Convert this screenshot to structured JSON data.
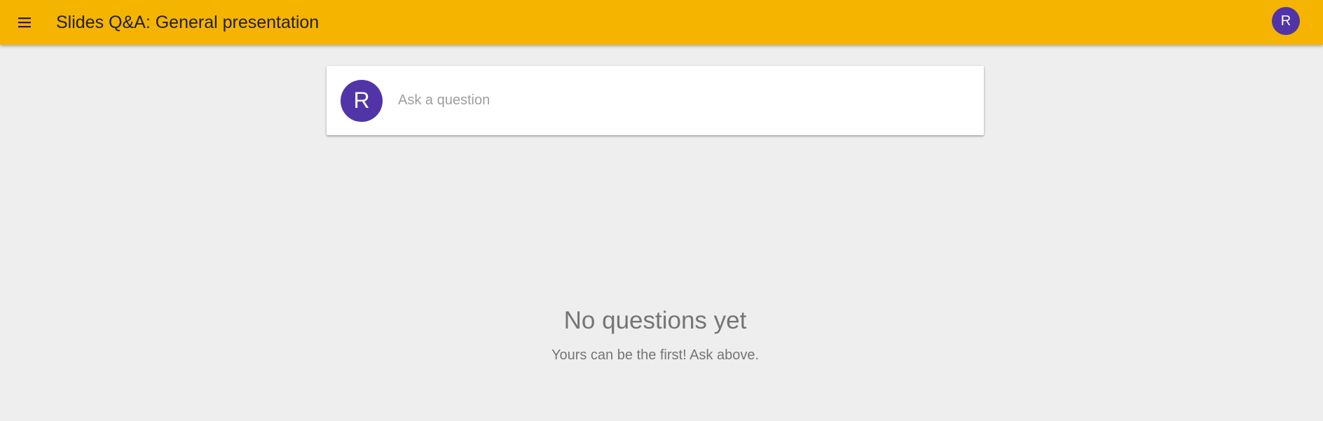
{
  "theme": {
    "accent": "#f5b400",
    "avatar": "#5135a8"
  },
  "header": {
    "menu_icon": "menu-icon",
    "title": "Slides Q&A: General presentation",
    "user_initial": "R"
  },
  "ask": {
    "user_initial": "R",
    "placeholder": "Ask a question",
    "value": ""
  },
  "empty": {
    "title": "No questions yet",
    "subtitle": "Yours can be the first! Ask above."
  }
}
